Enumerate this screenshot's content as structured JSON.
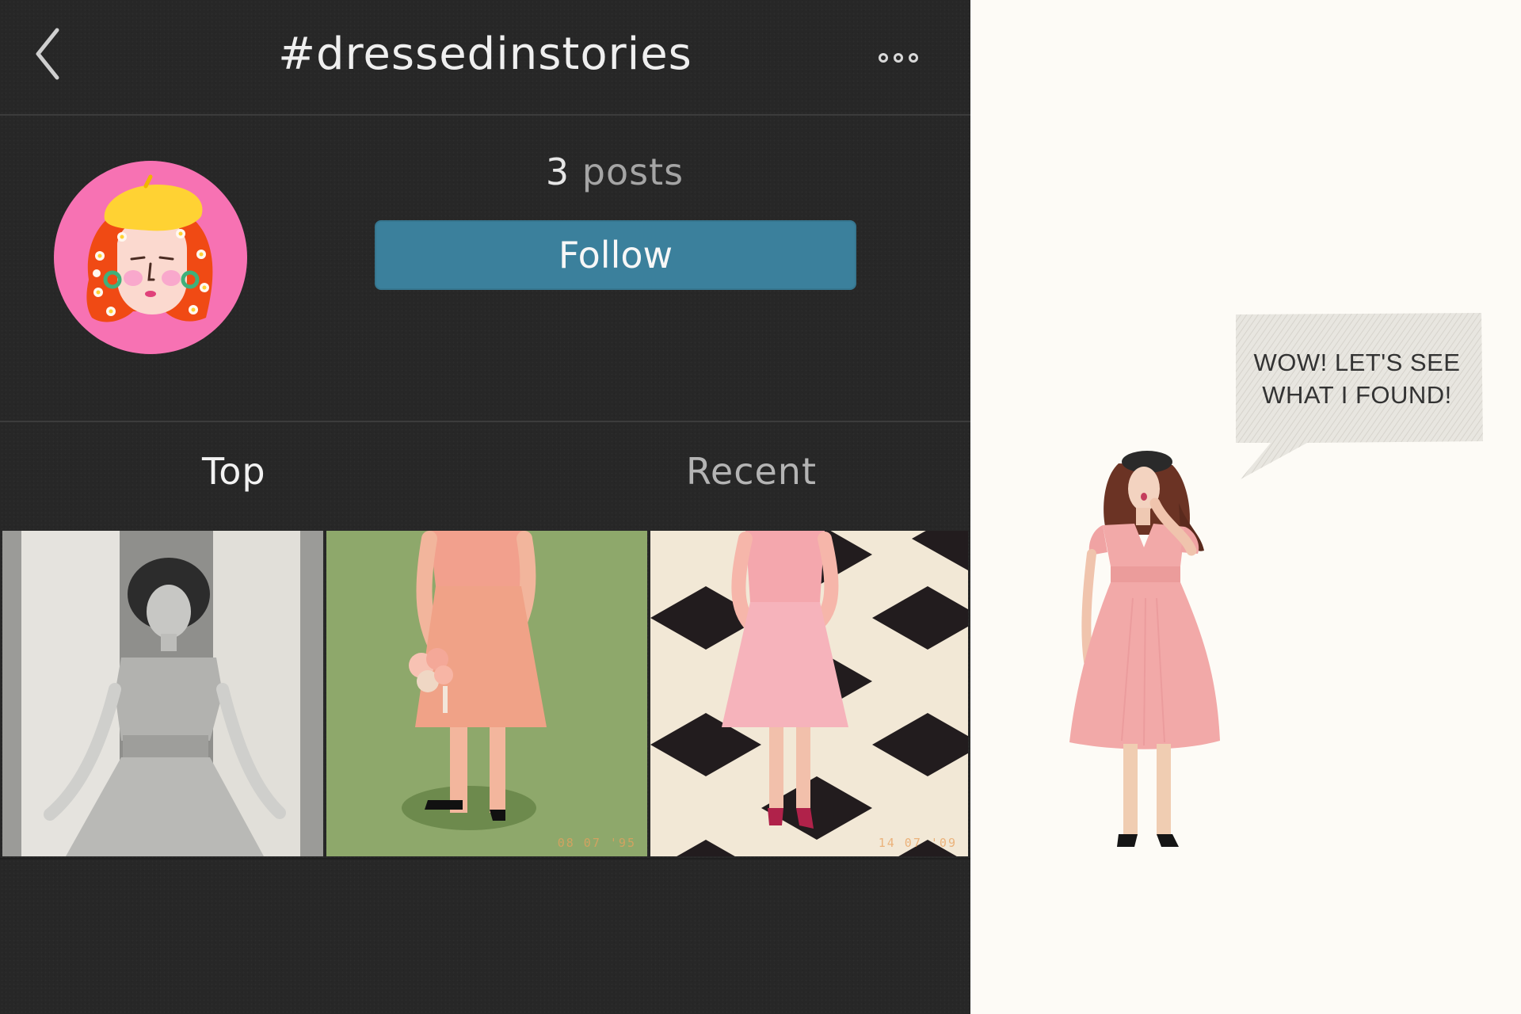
{
  "header": {
    "title": "#dressedinstories",
    "back_icon": "chevron-left-icon",
    "more_icon": "more-horizontal-icon"
  },
  "profile": {
    "posts_count": "3",
    "posts_label": "posts",
    "follow_label": "Follow"
  },
  "tabs": [
    {
      "label": "Top",
      "active": true
    },
    {
      "label": "Recent",
      "active": false
    }
  ],
  "posts": [
    {
      "stamp": ""
    },
    {
      "stamp": "08 07 '95"
    },
    {
      "stamp": "14 07 '09"
    }
  ],
  "story": {
    "speech": "WOW! LET'S SEE\nWHAT I FOUND!"
  },
  "colors": {
    "background": "#272727",
    "follow_button": "#3b809c",
    "avatar_bg": "#f772b3",
    "side_panel": "#fdfbf6"
  }
}
